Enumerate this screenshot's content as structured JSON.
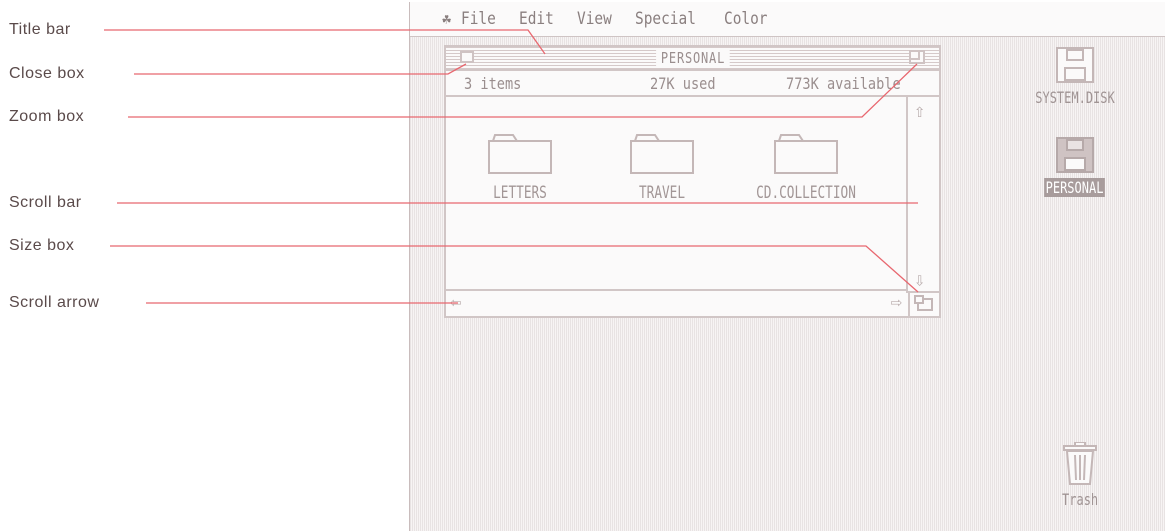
{
  "callouts": [
    {
      "label": "Title bar"
    },
    {
      "label": "Close box"
    },
    {
      "label": "Zoom box"
    },
    {
      "label": "Scroll bar"
    },
    {
      "label": "Size box"
    },
    {
      "label": "Scroll arrow"
    }
  ],
  "menubar": {
    "apple_icon": "apple-icon",
    "items": [
      "File",
      "Edit",
      "View",
      "Special",
      "Color"
    ]
  },
  "window": {
    "title": "PERSONAL",
    "info": {
      "items": "3 items",
      "used": "27K used",
      "available": "773K available"
    },
    "folders": [
      {
        "label": "LETTERS"
      },
      {
        "label": "TRAVEL"
      },
      {
        "label": "CD.COLLECTION"
      }
    ]
  },
  "desktop": {
    "disks": [
      {
        "label": "SYSTEM.DISK"
      },
      {
        "label": "PERSONAL"
      }
    ],
    "trash": "Trash"
  },
  "colors": {
    "callout_line": "#e8676f",
    "ui_gray": "#cfc3c3"
  }
}
